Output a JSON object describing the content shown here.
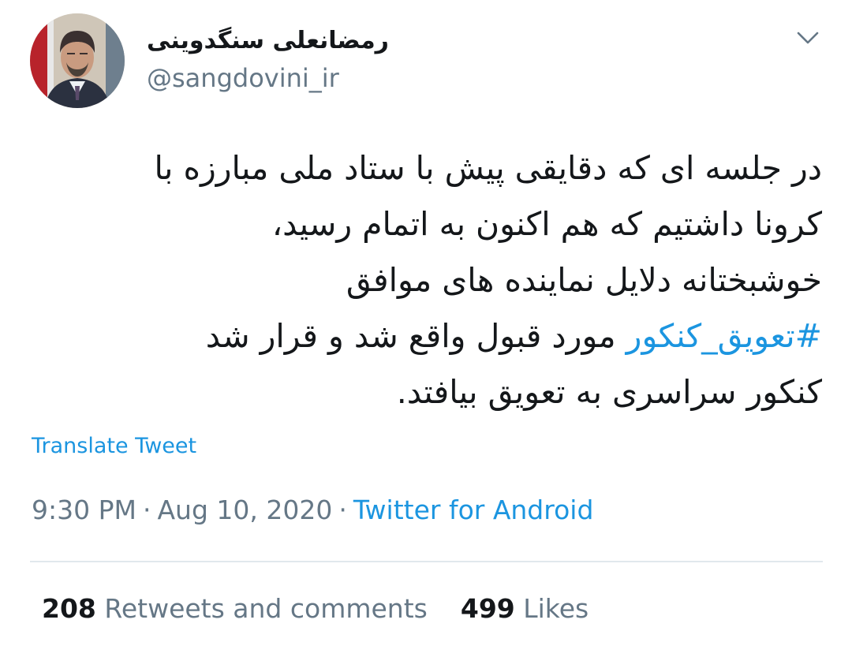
{
  "author": {
    "display_name": "رمضانعلی سنگدوینی",
    "handle": "@sangdovini_ir",
    "avatar": "profile-photo"
  },
  "tweet": {
    "lines": [
      "در جلسه ای که دقایقی پیش با ستاد ملی مبارزه با",
      "کرونا داشتیم که هم اکنون به اتمام رسید،",
      "خوشبختانه دلایل نماینده های موافق"
    ],
    "hashtag": "#تعویق_کنکور",
    "line4_rest": " مورد قبول واقع شد و قرار شد",
    "line5": "کنکور سراسری به تعویق بیافتد."
  },
  "translate_label": "Translate Tweet",
  "meta": {
    "time": "9:30 PM",
    "separator": "·",
    "date": "Aug 10, 2020",
    "source": "Twitter for Android"
  },
  "stats": {
    "retweets_count": "208",
    "retweets_label": "Retweets and comments",
    "likes_count": "499",
    "likes_label": "Likes"
  },
  "colors": {
    "text": "#14171a",
    "secondary": "#657786",
    "link": "#1b95e0",
    "divider": "#e1e8ed"
  },
  "icons": {
    "menu": "chevron-down-icon"
  }
}
